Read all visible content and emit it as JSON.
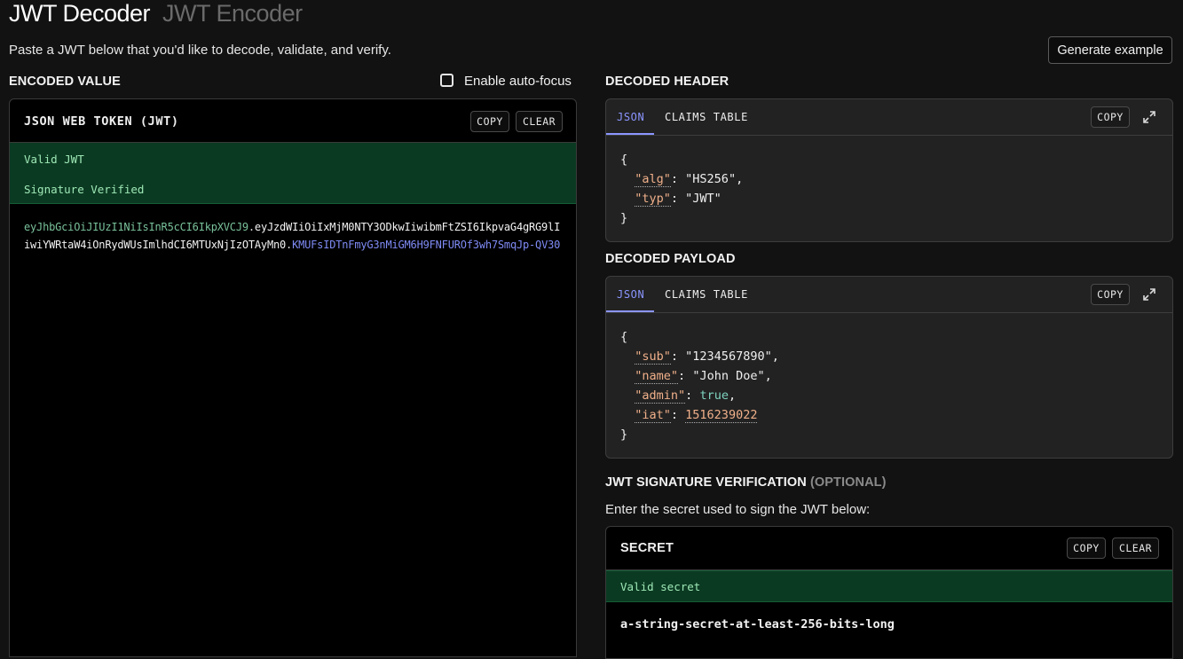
{
  "tabs": {
    "decoder": "JWT Decoder",
    "encoder": "JWT Encoder"
  },
  "subtitle": "Paste a JWT below that you'd like to decode, validate, and verify.",
  "generate_button": "Generate example",
  "encoded": {
    "section_title": "ENCODED VALUE",
    "autofocus_label": "Enable auto-focus",
    "panel_title": "JSON WEB TOKEN (JWT)",
    "copy": "COPY",
    "clear": "CLEAR",
    "status_valid": "Valid JWT",
    "status_signature": "Signature Verified",
    "token_header": "eyJhbGciOiJIUzI1NiIsInR5cCI6IkpXVCJ9",
    "token_payload": "eyJzdWIiOiIxMjM0NTY3ODkwIiwibmFtZSI6IkpvaG4gRG9lIiwiYWRtaW4iOnRydWUsImlhdCI6MTUxNjIzOTAyMn0",
    "token_signature": "KMUFsIDTnFmyG3nMiGM6H9FNFUROf3wh7SmqJp-QV30"
  },
  "header": {
    "section_title": "DECODED HEADER",
    "tab_json": "JSON",
    "tab_claims": "CLAIMS TABLE",
    "copy": "COPY",
    "open_brace": "{",
    "close_brace": "}",
    "alg_key": "\"alg\"",
    "alg_value": "\"HS256\"",
    "typ_key": "\"typ\"",
    "typ_value": "\"JWT\""
  },
  "payload": {
    "section_title": "DECODED PAYLOAD",
    "tab_json": "JSON",
    "tab_claims": "CLAIMS TABLE",
    "copy": "COPY",
    "open_brace": "{",
    "close_brace": "}",
    "sub_key": "\"sub\"",
    "sub_value": "\"1234567890\"",
    "name_key": "\"name\"",
    "name_value": "\"John Doe\"",
    "admin_key": "\"admin\"",
    "admin_value": "true",
    "iat_key": "\"iat\"",
    "iat_value": "1516239022"
  },
  "verification": {
    "section_title": "JWT SIGNATURE VERIFICATION",
    "optional": "(OPTIONAL)",
    "instruction": "Enter the secret used to sign the JWT below:",
    "secret_title": "SECRET",
    "copy": "COPY",
    "clear": "CLEAR",
    "secret_status": "Valid secret",
    "secret_value": "a-string-secret-at-least-256-bits-long"
  },
  "colors": {
    "accent": "#8b95ff",
    "valid_bg": "#0b3a22",
    "valid_text": "#9ee8b6",
    "json_key": "#f0b08a",
    "json_bool": "#7fd4c0"
  }
}
